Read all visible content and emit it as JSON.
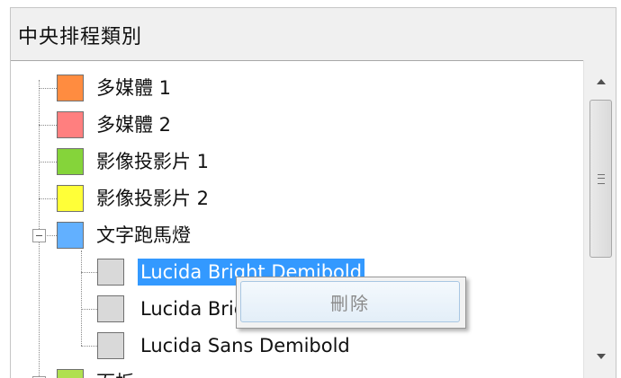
{
  "panel": {
    "title": "中央排程類別"
  },
  "tree": {
    "items": [
      {
        "label": "多媒體 1",
        "color": "#ff8c40"
      },
      {
        "label": "多媒體 2",
        "color": "#ff7f7f"
      },
      {
        "label": "影像投影片 1",
        "color": "#85d43a"
      },
      {
        "label": "影像投影片 2",
        "color": "#ffff38"
      },
      {
        "label": "文字跑馬燈",
        "color": "#62b0ff",
        "expanded": true,
        "children": [
          {
            "label": "Lucida Bright Demibold",
            "color": "#d9d9d9",
            "selected": true
          },
          {
            "label": "Lucida Bright Demibold",
            "color": "#d9d9d9"
          },
          {
            "label": "Lucida Sans Demibold",
            "color": "#d9d9d9"
          }
        ]
      },
      {
        "label": "面板",
        "color": "#b0e050"
      }
    ]
  },
  "context_menu": {
    "items": [
      {
        "label": "刪除",
        "enabled": false
      }
    ]
  },
  "scrollbar": {
    "up_icon": "scroll-up-arrow",
    "down_icon": "scroll-down-arrow"
  }
}
